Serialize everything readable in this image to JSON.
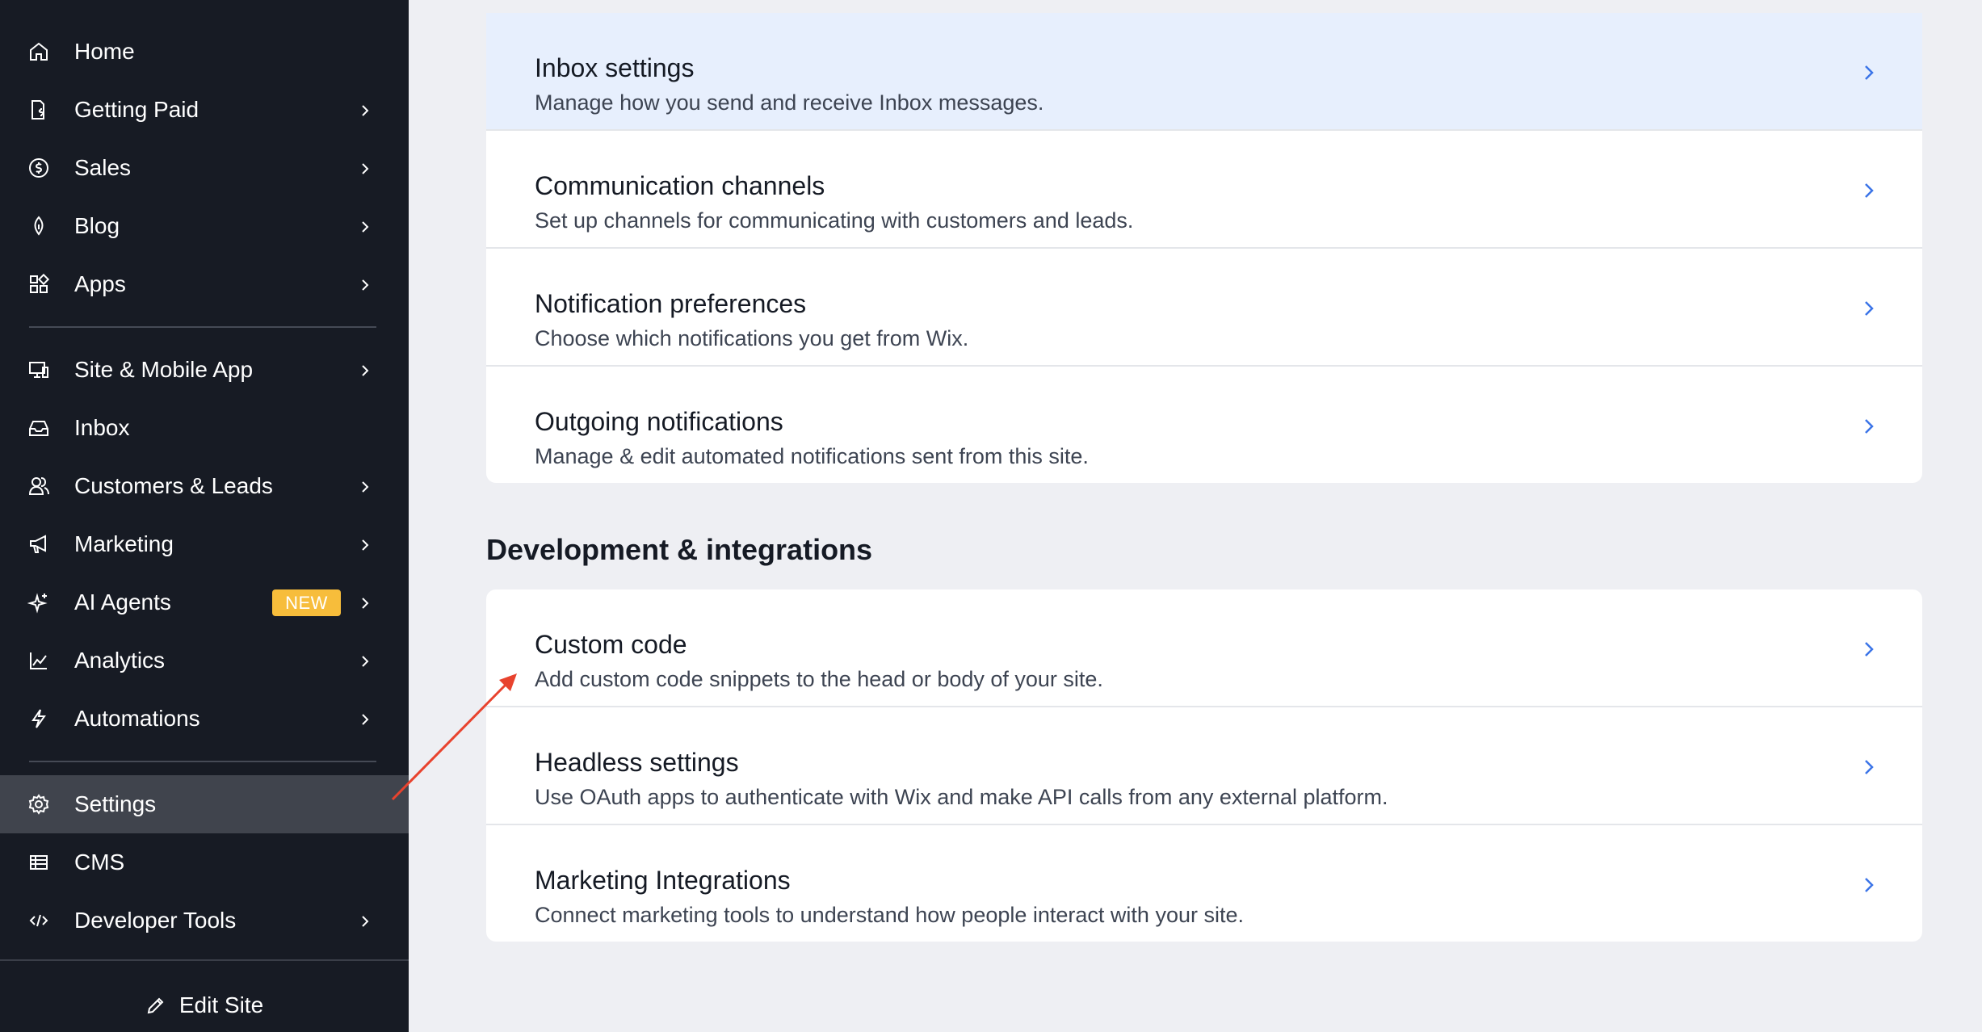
{
  "sidebar": {
    "items": [
      {
        "label": "Home",
        "icon": "home-icon",
        "chevron": false
      },
      {
        "label": "Getting Paid",
        "icon": "invoice-icon",
        "chevron": true
      },
      {
        "label": "Sales",
        "icon": "dollar-icon",
        "chevron": true
      },
      {
        "label": "Blog",
        "icon": "pen-nib-icon",
        "chevron": true
      },
      {
        "label": "Apps",
        "icon": "apps-icon",
        "chevron": true
      },
      {
        "label": "Site & Mobile App",
        "icon": "devices-icon",
        "chevron": true
      },
      {
        "label": "Inbox",
        "icon": "inbox-icon",
        "chevron": false
      },
      {
        "label": "Customers & Leads",
        "icon": "people-icon",
        "chevron": true
      },
      {
        "label": "Marketing",
        "icon": "megaphone-icon",
        "chevron": true
      },
      {
        "label": "AI Agents",
        "icon": "sparkle-icon",
        "chevron": true,
        "badge": "NEW"
      },
      {
        "label": "Analytics",
        "icon": "chart-icon",
        "chevron": true
      },
      {
        "label": "Automations",
        "icon": "lightning-icon",
        "chevron": true
      },
      {
        "label": "Settings",
        "icon": "gear-icon",
        "chevron": false,
        "active": true
      },
      {
        "label": "CMS",
        "icon": "table-icon",
        "chevron": false
      },
      {
        "label": "Developer Tools",
        "icon": "code-icon",
        "chevron": true
      }
    ],
    "edit_site_label": "Edit Site"
  },
  "main": {
    "top_card": [
      {
        "title": "Inbox settings",
        "desc": "Manage how you send and receive Inbox messages.",
        "highlighted": true
      },
      {
        "title": "Communication channels",
        "desc": "Set up channels for communicating with customers and leads."
      },
      {
        "title": "Notification preferences",
        "desc": "Choose which notifications you get from Wix."
      },
      {
        "title": "Outgoing notifications",
        "desc": "Manage & edit automated notifications sent from this site."
      }
    ],
    "section_title": "Development & integrations",
    "dev_card": [
      {
        "title": "Custom code",
        "desc": "Add custom code snippets to the head or body of your site."
      },
      {
        "title": "Headless settings",
        "desc": "Use OAuth apps to authenticate with Wix and make API calls from any external platform."
      },
      {
        "title": "Marketing Integrations",
        "desc": "Connect marketing tools to understand how people interact with your site."
      }
    ]
  },
  "colors": {
    "sidebar_bg": "#171b24",
    "active_bg": "#40444d",
    "badge": "#f7bd3b",
    "chevron_blue": "#3b74e8",
    "highlight_row": "#e7effd",
    "annotation_arrow": "#e8432e"
  }
}
